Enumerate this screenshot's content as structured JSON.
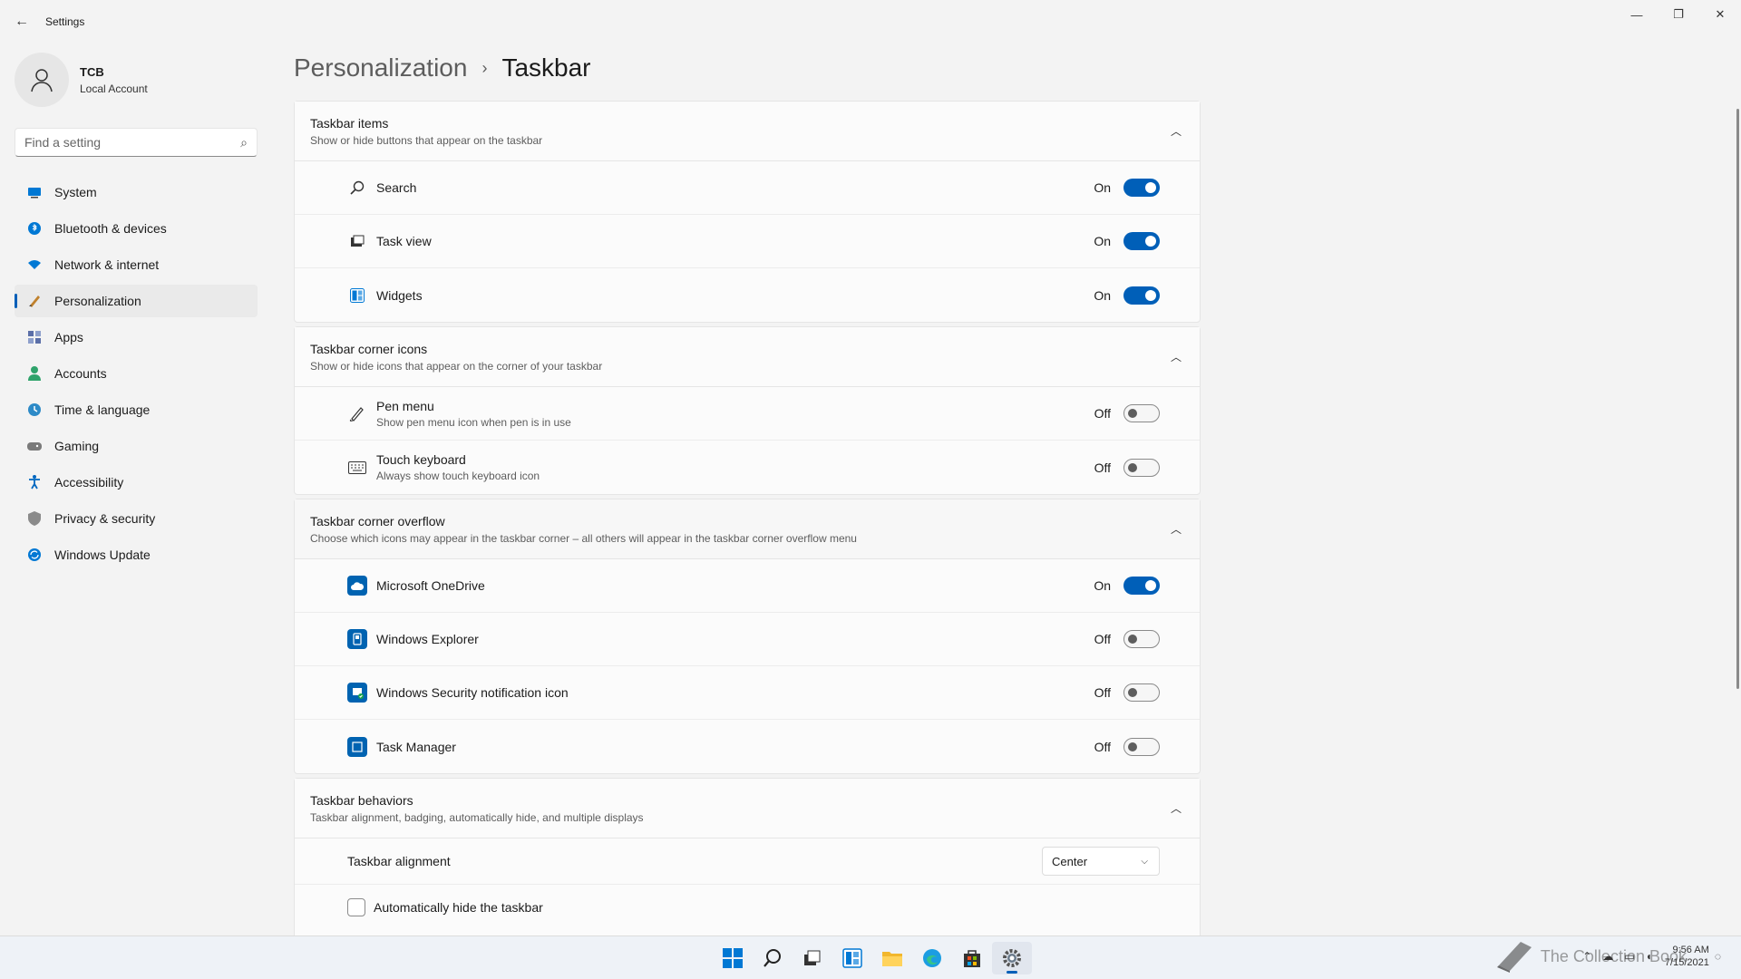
{
  "app": {
    "title": "Settings"
  },
  "user": {
    "name": "TCB",
    "account_type": "Local Account"
  },
  "search": {
    "placeholder": "Find a setting"
  },
  "nav": [
    {
      "label": "System",
      "icon": "monitor-icon",
      "color": "#0078d4"
    },
    {
      "label": "Bluetooth & devices",
      "icon": "bluetooth-icon",
      "color": "#0078d4"
    },
    {
      "label": "Network & internet",
      "icon": "wifi-icon",
      "color": "#0078d4"
    },
    {
      "label": "Personalization",
      "icon": "brush-icon",
      "color": "#c0812d",
      "active": true
    },
    {
      "label": "Apps",
      "icon": "apps-icon",
      "color": "#5b6fa8"
    },
    {
      "label": "Accounts",
      "icon": "person-icon",
      "color": "#2fa36b"
    },
    {
      "label": "Time & language",
      "icon": "globe-clock-icon",
      "color": "#2d8ac7"
    },
    {
      "label": "Gaming",
      "icon": "gamepad-icon",
      "color": "#7a7a7a"
    },
    {
      "label": "Accessibility",
      "icon": "accessibility-icon",
      "color": "#0067c0"
    },
    {
      "label": "Privacy & security",
      "icon": "shield-icon",
      "color": "#8a8a8a"
    },
    {
      "label": "Windows Update",
      "icon": "update-icon",
      "color": "#0078d4"
    }
  ],
  "breadcrumb": {
    "parent": "Personalization",
    "separator": "›",
    "current": "Taskbar"
  },
  "sections": {
    "items": {
      "title": "Taskbar items",
      "subtitle": "Show or hide buttons that appear on the taskbar",
      "rows": [
        {
          "label": "Search",
          "state": "On",
          "icon": "search-icon"
        },
        {
          "label": "Task view",
          "state": "On",
          "icon": "task-view-icon"
        },
        {
          "label": "Widgets",
          "state": "On",
          "icon": "widgets-icon"
        }
      ]
    },
    "corner_icons": {
      "title": "Taskbar corner icons",
      "subtitle": "Show or hide icons that appear on the corner of your taskbar",
      "rows": [
        {
          "label": "Pen menu",
          "sub": "Show pen menu icon when pen is in use",
          "state": "Off",
          "icon": "pen-icon"
        },
        {
          "label": "Touch keyboard",
          "sub": "Always show touch keyboard icon",
          "state": "Off",
          "icon": "keyboard-icon"
        }
      ]
    },
    "overflow": {
      "title": "Taskbar corner overflow",
      "subtitle": "Choose which icons may appear in the taskbar corner – all others will appear in the taskbar corner overflow menu",
      "rows": [
        {
          "label": "Microsoft OneDrive",
          "state": "On",
          "icon": "onedrive-icon"
        },
        {
          "label": "Windows Explorer",
          "state": "Off",
          "icon": "explorer-icon"
        },
        {
          "label": "Windows Security notification icon",
          "state": "Off",
          "icon": "windows-security-icon"
        },
        {
          "label": "Task Manager",
          "state": "Off",
          "icon": "task-manager-icon"
        }
      ]
    },
    "behaviors": {
      "title": "Taskbar behaviors",
      "subtitle": "Taskbar alignment, badging, automatically hide, and multiple displays",
      "alignment_label": "Taskbar alignment",
      "alignment_value": "Center",
      "autohide_label": "Automatically hide the taskbar"
    }
  },
  "taskbar": {
    "time": "9:56 AM",
    "date": "7/15/2021",
    "watermark": "The Collection Book"
  },
  "colors": {
    "accent": "#005fb8"
  }
}
